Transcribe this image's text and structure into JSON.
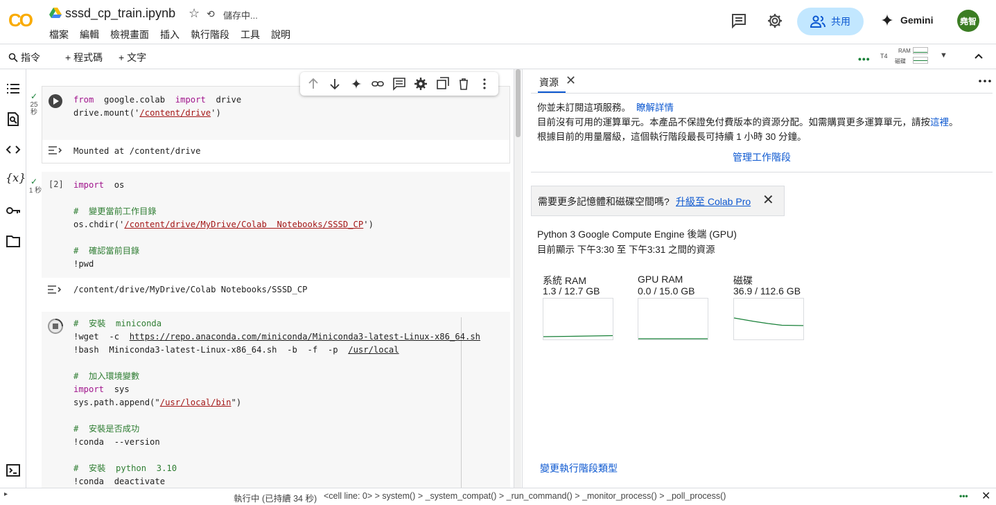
{
  "app": {
    "filename": "sssd_cp_train.ipynb",
    "save_status": "儲存中...",
    "menu": [
      "檔案",
      "編輯",
      "檢視畫面",
      "插入",
      "執行階段",
      "工具",
      "說明"
    ],
    "share_label": "共用",
    "gemini_label": "Gemini",
    "avatar_text": "堯智"
  },
  "toolbar": {
    "command_label": "指令",
    "add_code_label": "+ 程式碼",
    "add_text_label": "+ 文字",
    "gpu_label": "T4",
    "ram_label": "RAM",
    "disk_label": "磁碟"
  },
  "cells": [
    {
      "run_mark": "25\n秒",
      "code": [
        "from google.colab import drive",
        "drive.mount('/content/drive')"
      ],
      "output": "Mounted at /content/drive"
    },
    {
      "counter": "[2]",
      "run_mark": "1 秒",
      "code_lines": {
        "l1_kw": "import",
        "l1_rest": "  os",
        "l3": "#  變更當前工作目錄",
        "l4_pre": "os.chdir('",
        "l4_str": "/content/drive/MyDrive/Colab  Notebooks/SSSD_CP",
        "l4_post": "')",
        "l6": "#  確認當前目錄",
        "l7": "!pwd"
      },
      "output": "/content/drive/MyDrive/Colab Notebooks/SSSD_CP"
    },
    {
      "code_lines": {
        "l1": "#  安裝  miniconda",
        "l2_pre": "!wget  -c  ",
        "l2_link": "https://repo.anaconda.com/miniconda/Miniconda3-latest-Linux-x86_64.sh",
        "l3_pre": "!bash  Miniconda3-latest-Linux-x86_64.sh  -b  -f  -p  ",
        "l3_link": "/usr/local",
        "l5": "#  加入環境變數",
        "l6_kw": "import",
        "l6_rest": "  sys",
        "l7_pre": "sys.path.append(\"",
        "l7_str": "/usr/local/bin",
        "l7_post": "\")",
        "l9": "#  安裝是否成功",
        "l10": "!conda  --version",
        "l12": "#  安裝  python  3.10",
        "l13": "!conda  deactivate"
      }
    }
  ],
  "panel": {
    "tab_label": "資源",
    "line1": "你並未訂閱這項服務。",
    "line1_link": "瞭解詳情",
    "line2": "目前沒有可用的運算單元。本產品不保證免付費版本的資源分配。如需購買更多運算單元，請按",
    "line2_link": "這裡",
    "line2_end": "。",
    "line3": "根據目前的用量層級，這個執行階段最長可持續 1 小時 30 分鐘。",
    "manage_link": "管理工作階段",
    "upgrade_text": "需要更多記憶體和磁碟空間嗎?",
    "upgrade_link": "升級至 Colab Pro",
    "backend": "Python 3 Google Compute Engine 後端 (GPU)",
    "time_range": "目前顯示 下午3:30 至 下午3:31 之間的資源",
    "gauges": [
      {
        "label": "系統 RAM",
        "value": "1.3 / 12.7 GB",
        "fraction": 0.1
      },
      {
        "label": "GPU RAM",
        "value": "0.0 / 15.0 GB",
        "fraction": 0.0
      },
      {
        "label": "磁碟",
        "value": "36.9 / 112.6 GB",
        "fraction": 0.33
      }
    ],
    "change_runtime": "變更執行階段類型"
  },
  "status": {
    "text": "執行中 (已持續 34 秒)",
    "trace": "<cell line: 0> > system() > _system_compat() > _run_command() > _monitor_process() > _poll_process()"
  },
  "colors": {
    "accent": "#0b57d0",
    "share_bg": "#c2e7ff",
    "green": "#188038",
    "logo_orange": "#f9ab00"
  }
}
